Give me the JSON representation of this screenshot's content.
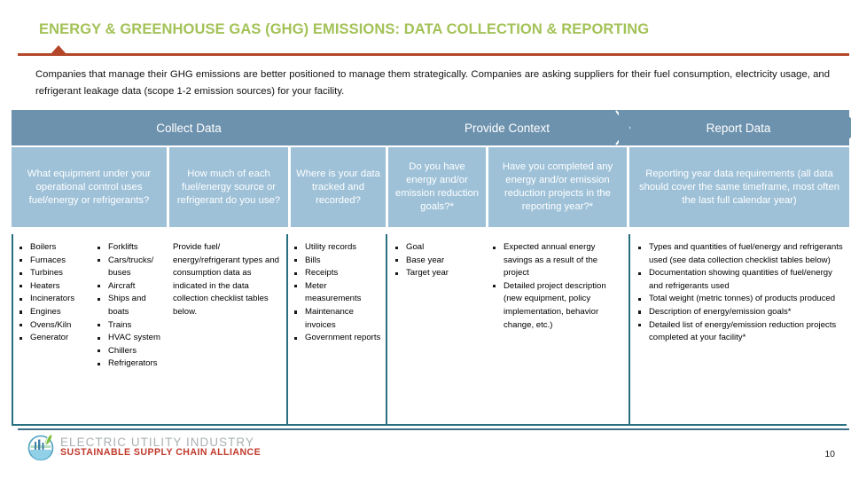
{
  "slide": {
    "title": "ENERGY & GREENHOUSE GAS (GHG) EMISSIONS:  DATA COLLECTION & REPORTING",
    "intro": "Companies that manage their GHG emissions are better positioned to manage them strategically.  Companies are asking suppliers for their fuel consumption, electricity usage, and refrigerant leakage data (scope 1-2 emission sources) for your facility.",
    "page_number": "10",
    "colors": {
      "title_green": "#A3C257",
      "rule_rust": "#B4462A",
      "chevron_blue": "#6D92AE",
      "question_blue": "#9EC1D8",
      "border_teal": "#28707F",
      "footer_rule": "#3E6F88",
      "logo_red": "#C0392B",
      "logo_gray": "#A9B0B3"
    }
  },
  "phases": [
    {
      "label": "Collect Data"
    },
    {
      "label": "Provide Context"
    },
    {
      "label": "Report Data"
    }
  ],
  "questions": [
    {
      "text": "What equipment under your operational control uses fuel/energy or refrigerants?"
    },
    {
      "text": "How much of each fuel/energy source or refrigerant do you use?"
    },
    {
      "text": "Where is your data tracked and recorded?"
    },
    {
      "text": "Do you have energy and/or emission reduction goals?*"
    },
    {
      "text": "Have you completed any energy and/or emission reduction projects in the reporting year?*"
    },
    {
      "text": "Reporting year data requirements (all data should cover the same timeframe, most often the last full calendar year)"
    }
  ],
  "columns": [
    {
      "type": "bullets",
      "items": [
        "Boilers",
        "Furnaces",
        "Turbines",
        "Heaters",
        "Incinerators",
        "Engines",
        "Ovens/Kiln",
        "Generator"
      ]
    },
    {
      "type": "bullets",
      "items": [
        "Forklifts",
        "Cars/trucks/ buses",
        "Aircraft",
        "Ships and boats",
        "Trains",
        "HVAC system",
        "Chillers",
        "Refrigerators"
      ]
    },
    {
      "type": "paragraph",
      "text": "Provide fuel/ energy/refrigerant types and consumption data as indicated in the data collection checklist tables below."
    },
    {
      "type": "bullets",
      "items": [
        "Utility records",
        "Bills",
        "Receipts",
        "Meter measurements",
        "Maintenance invoices",
        "Government reports"
      ]
    },
    {
      "type": "bullets",
      "items": [
        "Goal",
        "Base year",
        "Target year"
      ]
    },
    {
      "type": "bullets",
      "items": [
        "Expected annual energy savings as a result of the project",
        "Detailed project description (new equipment, policy implementation, behavior change, etc.)"
      ]
    },
    {
      "type": "bullets",
      "items": [
        "Types and quantities of fuel/energy and refrigerants used (see data collection checklist tables below)",
        "Documentation showing quantities of fuel/energy and refrigerants used",
        "Total weight (metric tonnes) of products produced",
        "Description of energy/emission goals*",
        "Detailed list of energy/emission reduction projects completed at your facility*"
      ]
    }
  ],
  "logo": {
    "line1": "ELECTRIC UTILITY INDUSTRY",
    "line2": "SUSTAINABLE SUPPLY CHAIN ALLIANCE"
  }
}
